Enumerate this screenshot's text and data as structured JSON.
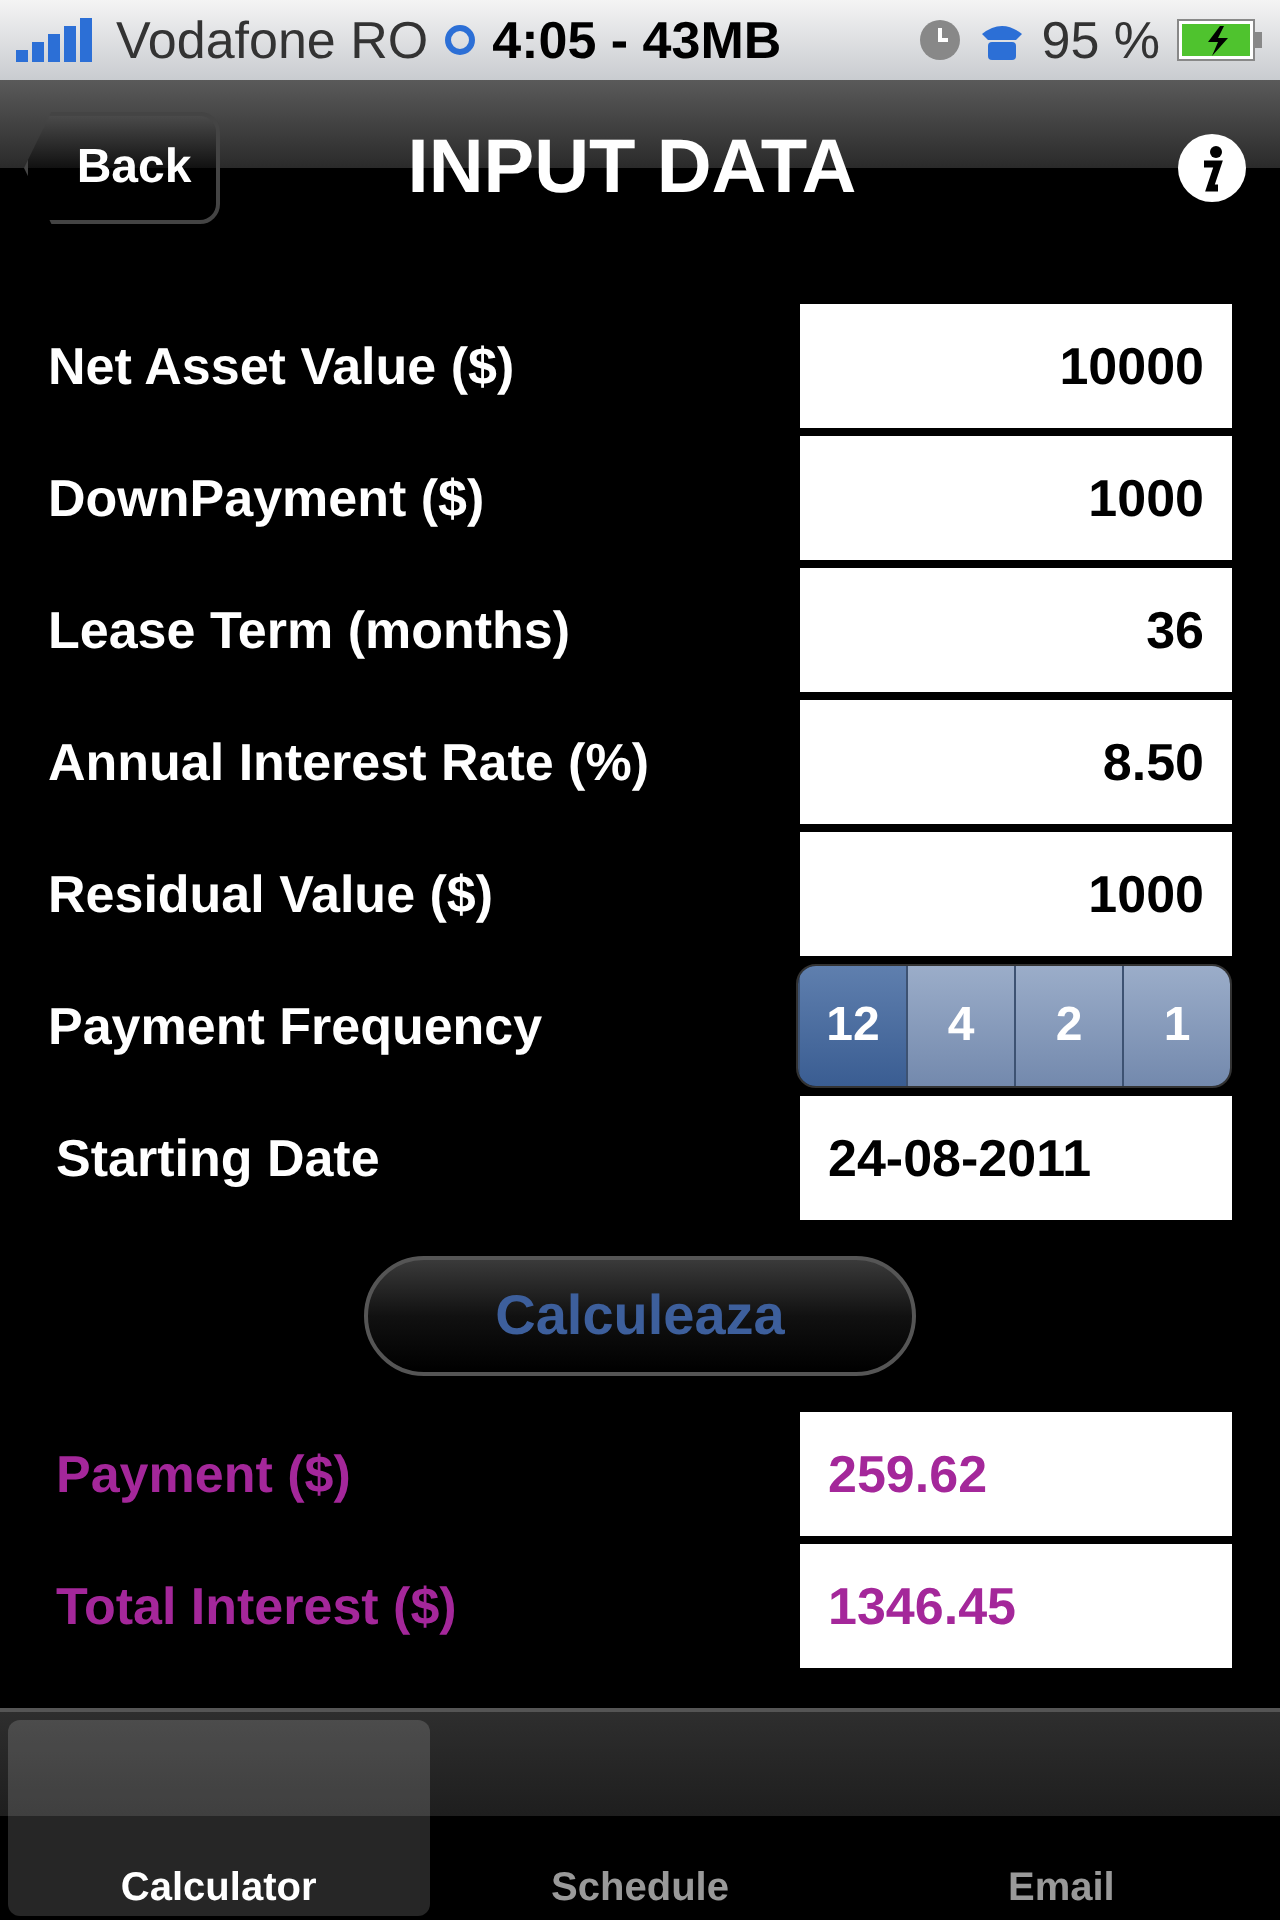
{
  "status_bar": {
    "carrier": "Vodafone RO",
    "time": "4:05 - 43MB",
    "battery": "95 %"
  },
  "nav": {
    "back": "Back",
    "title": "INPUT DATA"
  },
  "inputs": [
    {
      "kind": "field",
      "label": "Net Asset Value ($)",
      "value": "10000"
    },
    {
      "kind": "field",
      "label": "DownPayment ($)",
      "value": "1000"
    },
    {
      "kind": "field",
      "label": "Lease Term (months)",
      "value": "36"
    },
    {
      "kind": "field",
      "label": "Annual Interest Rate (%)",
      "value": "8.50"
    },
    {
      "kind": "field",
      "label": "Residual Value ($)",
      "value": "1000"
    },
    {
      "kind": "segmented",
      "label": "Payment Frequency",
      "options": [
        {
          "label": "12",
          "selected": true
        },
        {
          "label": "4",
          "selected": false
        },
        {
          "label": "2",
          "selected": false
        },
        {
          "label": "1",
          "selected": false
        }
      ]
    },
    {
      "kind": "date",
      "label": "Starting Date",
      "value": "24-08-2011"
    }
  ],
  "calculate_button": "Calculeaza",
  "results": [
    {
      "label": "Payment ($)",
      "value": "259.62"
    },
    {
      "label": "Total Interest ($)",
      "value": "1346.45"
    }
  ],
  "tabs": [
    {
      "label": "Calculator",
      "selected": true
    },
    {
      "label": "Schedule",
      "selected": false
    },
    {
      "label": "Email",
      "selected": false
    }
  ]
}
